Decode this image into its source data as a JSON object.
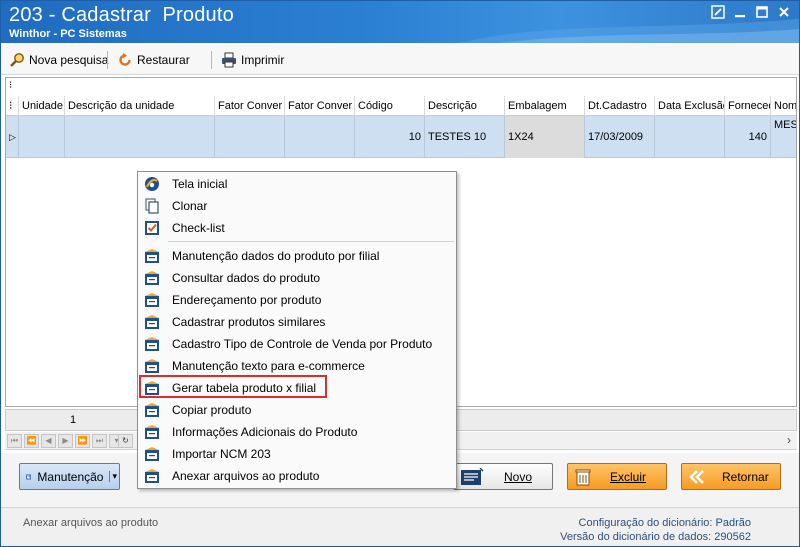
{
  "window": {
    "title": "203 - Cadastrar  Produto",
    "subtitle": "Winthor - PC Sistemas"
  },
  "toolbar": {
    "nova_pesquisa": "Nova pesquisa",
    "restaurar": "Restaurar",
    "imprimir": "Imprimir"
  },
  "grid": {
    "columns": [
      "Unidade",
      "Descrição da unidade",
      "Fator Conver",
      "Fator Conver",
      "Código",
      "Descrição",
      "Embalagem",
      "Dt.Cadastro",
      "Data Exclusão",
      "Fornecedo",
      "Nom"
    ],
    "row": {
      "unidade": "",
      "descricao_unidade": "",
      "fator1": "",
      "fator2": "",
      "codigo": "10",
      "descricao": "TESTES 10",
      "embalagem": "1X24",
      "dt_cadastro": "17/03/2009",
      "data_exclusao": "",
      "fornecedor": "140",
      "nome": "MESS"
    },
    "footer_value": "1"
  },
  "context_menu": {
    "items": [
      {
        "label": "Tela inicial",
        "icon": "home-icon"
      },
      {
        "label": "Clonar",
        "icon": "copy-icon"
      },
      {
        "label": "Check-list",
        "icon": "checklist-icon"
      },
      {
        "label": "Manutenção dados do produto por filial",
        "icon": "form-icon"
      },
      {
        "label": "Consultar dados do produto",
        "icon": "form-icon"
      },
      {
        "label": "Endereçamento por produto",
        "icon": "form-icon"
      },
      {
        "label": "Cadastrar produtos similares",
        "icon": "form-icon"
      },
      {
        "label": "Cadastro Tipo de Controle de Venda por Produto",
        "icon": "form-icon"
      },
      {
        "label": "Manutenção texto para e-commerce",
        "icon": "form-icon"
      },
      {
        "label": "Gerar tabela produto x filial",
        "icon": "form-icon"
      },
      {
        "label": "Copiar produto",
        "icon": "form-icon"
      },
      {
        "label": "Informações Adicionais do Produto",
        "icon": "form-icon"
      },
      {
        "label": "Importar NCM 203",
        "icon": "form-icon"
      },
      {
        "label": "Anexar arquivos ao produto",
        "icon": "form-icon"
      }
    ],
    "highlighted_index": 9,
    "highlight_color": "#e02b2b"
  },
  "buttons": {
    "manutencao": "Manutenção",
    "novo": "Novo",
    "excluir": "Excluir",
    "retornar": "Retornar"
  },
  "status": {
    "left": "Anexar arquivos ao produto",
    "config_label": "Configuração do dicionário:",
    "config_value": "Padrão",
    "version_label": "Versão do dicionário de dados:",
    "version_value": "290562"
  },
  "colors": {
    "titlebar": "#2b7fd3",
    "selected_row": "#cfdff2",
    "button_orange": "#f8a43a"
  }
}
